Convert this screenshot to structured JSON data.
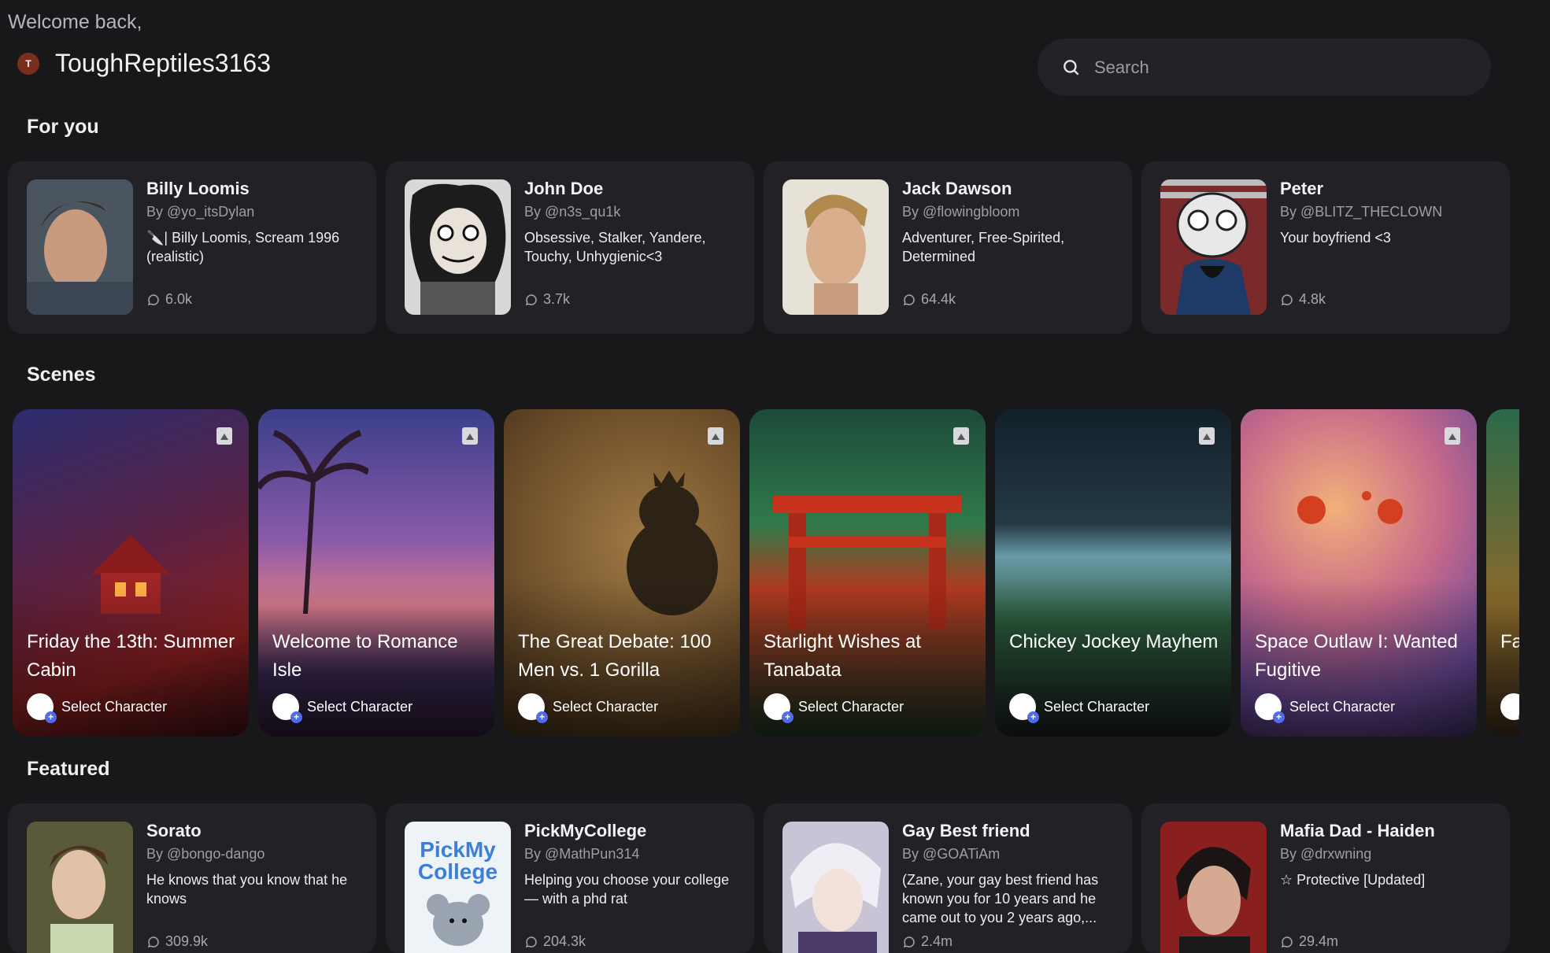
{
  "header": {
    "welcome": "Welcome back,",
    "avatar_initial": "T",
    "username": "ToughReptiles3163",
    "search_placeholder": "Search"
  },
  "sections": {
    "for_you": "For you",
    "scenes": "Scenes",
    "featured": "Featured"
  },
  "for_you": [
    {
      "name": "Billy Loomis",
      "by": "By @yo_itsDylan",
      "desc": "🔪| Billy Loomis, Scream 1996 (realistic)",
      "count": "6.0k"
    },
    {
      "name": "John Doe",
      "by": "By @n3s_qu1k",
      "desc": "Obsessive, Stalker, Yandere, Touchy, Unhygienic<3",
      "count": "3.7k"
    },
    {
      "name": "Jack Dawson",
      "by": "By @flowingbloom",
      "desc": "Adventurer, Free-Spirited, Determined",
      "count": "64.4k"
    },
    {
      "name": "Peter",
      "by": "By @BLITZ_THECLOWN",
      "desc": "Your boyfriend <3",
      "count": "4.8k"
    }
  ],
  "scenes": [
    {
      "title": "Friday the 13th: Summer Cabin",
      "select": "Select Character"
    },
    {
      "title": "Welcome to Romance Isle",
      "select": "Select Character"
    },
    {
      "title": "The Great Debate: 100 Men vs. 1 Gorilla",
      "select": "Select Character"
    },
    {
      "title": "Starlight Wishes at Tanabata",
      "select": "Select Character"
    },
    {
      "title": "Chickey Jockey Mayhem",
      "select": "Select Character"
    },
    {
      "title": "Space Outlaw I: Wanted Fugitive",
      "select": "Select Character"
    },
    {
      "title": "Fa",
      "select": ""
    }
  ],
  "featured": [
    {
      "name": "Sorato",
      "by": "By @bongo-dango",
      "desc": "He knows that you know that he knows",
      "count": "309.9k"
    },
    {
      "name": "PickMyCollege",
      "by": "By @MathPun314",
      "desc": "Helping you choose your college — with a phd rat",
      "count": "204.3k",
      "logo_text": "PickMy College"
    },
    {
      "name": "Gay Best friend",
      "by": "By @GOATiAm",
      "desc": "(Zane, your gay best friend has known you for 10 years and he came out to you 2 years ago,...",
      "count": "2.4m"
    },
    {
      "name": "Mafia Dad - Haiden",
      "by": "By @drxwning",
      "desc": "☆ Protective [Updated]",
      "count": "29.4m"
    }
  ]
}
